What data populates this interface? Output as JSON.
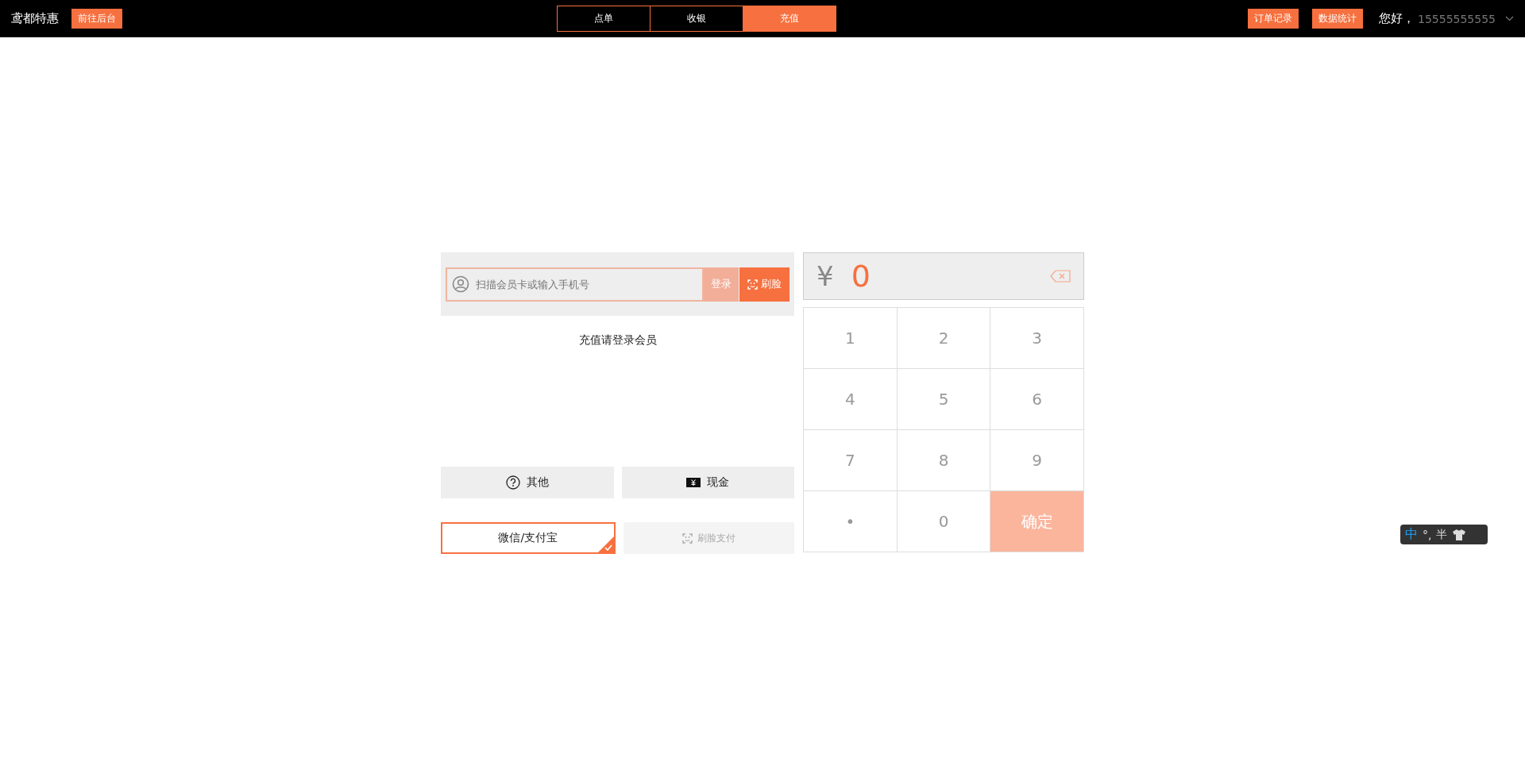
{
  "header": {
    "brand": "鸢都特惠",
    "backend_button": "前往后台",
    "tabs": [
      {
        "label": "点单",
        "selected": false
      },
      {
        "label": "收银",
        "selected": false
      },
      {
        "label": "充值",
        "selected": true
      }
    ],
    "actions": [
      "订单记录",
      "数据统计"
    ],
    "greeting": "您好，",
    "user": "15555555555"
  },
  "member": {
    "placeholder": "扫描会员卡或输入手机号",
    "login": {
      "label": "登录",
      "disabled": true
    },
    "face": "刷脸",
    "notice": "充值请登录会员"
  },
  "methods": [
    {
      "kind": "other",
      "label": "其他"
    },
    {
      "kind": "cash",
      "label": "现金"
    }
  ],
  "payments": [
    {
      "kind": "qr",
      "label": "微信/支付宝",
      "selected": true,
      "disabled": false
    },
    {
      "kind": "face",
      "label": "刷脸支付",
      "selected": false,
      "disabled": true
    }
  ],
  "display": {
    "currency": "¥",
    "amount": "0"
  },
  "keys": [
    {
      "kind": "digit",
      "label": "1"
    },
    {
      "kind": "digit",
      "label": "2"
    },
    {
      "kind": "digit",
      "label": "3"
    },
    {
      "kind": "digit",
      "label": "4"
    },
    {
      "kind": "digit",
      "label": "5"
    },
    {
      "kind": "digit",
      "label": "6"
    },
    {
      "kind": "digit",
      "label": "7"
    },
    {
      "kind": "digit",
      "label": "8"
    },
    {
      "kind": "digit",
      "label": "9"
    },
    {
      "kind": "digit",
      "label": "•"
    },
    {
      "kind": "digit",
      "label": "0"
    },
    {
      "kind": "confirm",
      "label": "确定",
      "disabled": true
    }
  ],
  "ime": {
    "mode": "中",
    "punct": "°,",
    "width": "半"
  }
}
